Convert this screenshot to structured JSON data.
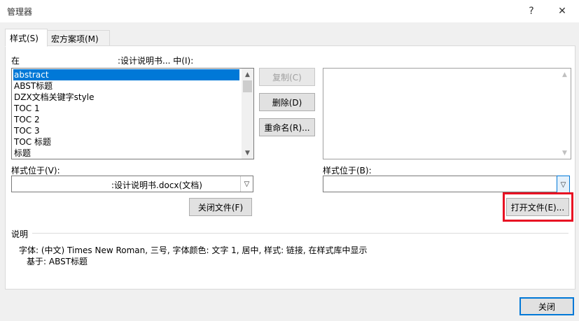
{
  "window": {
    "title": "管理器",
    "help_glyph": "?",
    "close_glyph": "✕"
  },
  "tabs": [
    {
      "label": "样式(S)"
    },
    {
      "label": "宏方案项(M)"
    }
  ],
  "left": {
    "in_label_prefix": "在",
    "in_label_suffix": ":设计说明书... 中(I):",
    "list_items": [
      "abstract",
      "ABST标题",
      "DZX文档关键字style",
      "TOC 1",
      "TOC 2",
      "TOC 3",
      "TOC 标题",
      "标题"
    ],
    "styles_in_label": "样式位于(V):",
    "combo_value": ":设计说明书.docx(文档)",
    "close_file_button": "关闭文件(F)"
  },
  "middle": {
    "copy_button": "复制(C)",
    "delete_button": "删除(D)",
    "rename_button": "重命名(R)..."
  },
  "right": {
    "styles_in_label": "样式位于(B):",
    "combo_value": "",
    "open_file_button": "打开文件(E)..."
  },
  "description": {
    "header": "说明",
    "line1": "字体: (中文) Times New Roman, 三号, 字体颜色: 文字 1, 居中, 样式: 链接, 在样式库中显示",
    "line2": "基于: ABST标题"
  },
  "footer": {
    "close_button": "关闭"
  },
  "colors": {
    "selection": "#0078d7",
    "highlight_box": "#e81123",
    "primary_border": "#0078d7"
  }
}
